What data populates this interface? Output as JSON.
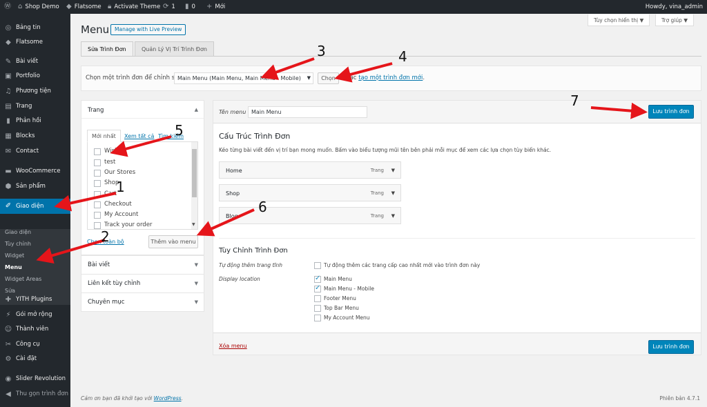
{
  "adminbar": {
    "site": "Shop Demo",
    "theme": "Flatsome",
    "activate": "Activate Theme",
    "updates": "1",
    "comments": "0",
    "new": "Mới",
    "howdy": "Howdy, vina_admin"
  },
  "sidebar": {
    "items": [
      "Bảng tin",
      "Flatsome",
      "Bài viết",
      "Portfolio",
      "Phương tiện",
      "Trang",
      "Phản hồi",
      "Blocks",
      "Contact",
      "WooCommerce",
      "Sản phẩm",
      "Giao diện",
      "YITH Plugins",
      "Gói mở rộng",
      "Thành viên",
      "Công cụ",
      "Cài đặt",
      "Slider Revolution",
      "Thu gọn trình đơn"
    ],
    "submenu": [
      "Giao diện",
      "Tùy chỉnh",
      "Widget",
      "Menu",
      "Widget Areas",
      "Sửa"
    ]
  },
  "header": {
    "title": "Menu",
    "live_btn": "Manage with Live Preview",
    "screen_options": "Tùy chọn hiển thị ▼",
    "help": "Trợ giúp ▼"
  },
  "tabs": [
    "Sửa Trình Đơn",
    "Quản Lý Vị Trí Trình Đơn"
  ],
  "select_bar": {
    "label": "Chọn một trình đơn để chỉnh sửa:",
    "selected": "Main Menu (Main Menu, Main Menu - Mobile)",
    "choose_btn": "Chọn",
    "or_text": "hoặc",
    "create_link": "tạo một trình đơn mới",
    "period": "."
  },
  "pages_box": {
    "title": "Trang",
    "tab_recent": "Mới nhất",
    "tab_all": "Xem tất cả",
    "tab_search": "Tìm kiếm",
    "items": [
      "Wishlist",
      "test",
      "Our Stores",
      "Shop",
      "Cart",
      "Checkout",
      "My Account",
      "Track your order"
    ],
    "select_all": "Chọn toàn bộ",
    "add_btn": "Thêm vào menu"
  },
  "accordions": [
    "Bài viết",
    "Liên kết tùy chỉnh",
    "Chuyên mục"
  ],
  "menu_editor": {
    "name_label": "Tên menu",
    "name_value": "Main Menu",
    "save_btn": "Lưu trình đơn",
    "structure_title": "Cấu Trúc Trình Đơn",
    "structure_desc": "Kéo từng bài viết đến vị trí bạn mong muốn. Bấm vào biểu tượng mũi tên bên phải mỗi mục để xem các lựa chọn tùy biến khác.",
    "items": [
      {
        "title": "Home",
        "type": "Trang"
      },
      {
        "title": "Shop",
        "type": "Trang"
      },
      {
        "title": "Blog",
        "type": "Trang"
      }
    ],
    "settings_title": "Tùy Chỉnh Trình Đơn",
    "auto_add_label": "Tự động thêm trang tĩnh",
    "auto_add_text": "Tự động thêm các trang cấp cao nhất mới vào trình đơn này",
    "display_label": "Display location",
    "locations": [
      {
        "name": "Main Menu",
        "checked": true
      },
      {
        "name": "Main Menu - Mobile",
        "checked": true
      },
      {
        "name": "Footer Menu",
        "checked": false
      },
      {
        "name": "Top Bar Menu",
        "checked": false
      },
      {
        "name": "My Account Menu",
        "checked": false
      }
    ],
    "delete_link": "Xóa menu"
  },
  "footer": {
    "thanks": "Cảm ơn bạn đã khởi tạo với",
    "wp_link": "WordPress",
    "period": ".",
    "version": "Phiên bản 4.7.1"
  },
  "annotations": [
    "1",
    "2",
    "3",
    "4",
    "5",
    "6",
    "7"
  ],
  "colors": {
    "adminbar": "#23282d",
    "active": "#0073aa",
    "primary_btn": "#0085ba",
    "arrow": "#e5151a"
  }
}
